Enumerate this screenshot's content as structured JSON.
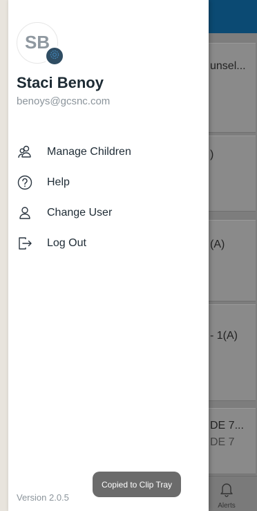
{
  "drawer": {
    "avatar_initials": "SB",
    "user_name": "Staci Benoy",
    "user_email": "benoys@gcsnc.com",
    "menu": [
      {
        "label": "Manage Children",
        "icon": "users-icon"
      },
      {
        "label": "Help",
        "icon": "help-circle-icon"
      },
      {
        "label": "Change User",
        "icon": "user-icon"
      },
      {
        "label": "Log Out",
        "icon": "logout-icon"
      }
    ],
    "version": "Version 2.0.5"
  },
  "toast": {
    "text": "Copied to Clip Tray"
  },
  "underlay": {
    "cards": [
      {
        "text": "unsel..."
      },
      {
        "text": ")"
      },
      {
        "text": "(A)"
      },
      {
        "text": "- 1(A)"
      },
      {
        "text": "DE 7...",
        "sub": "DE 7"
      }
    ],
    "bottom_nav": {
      "alerts_label": "Alerts"
    }
  },
  "colors": {
    "topbar": "#0b4a73",
    "badge": "#2f4d63",
    "name_text": "#1c2a33",
    "secondary_text": "#8b949b",
    "toast_bg": "#6b6b6b"
  }
}
